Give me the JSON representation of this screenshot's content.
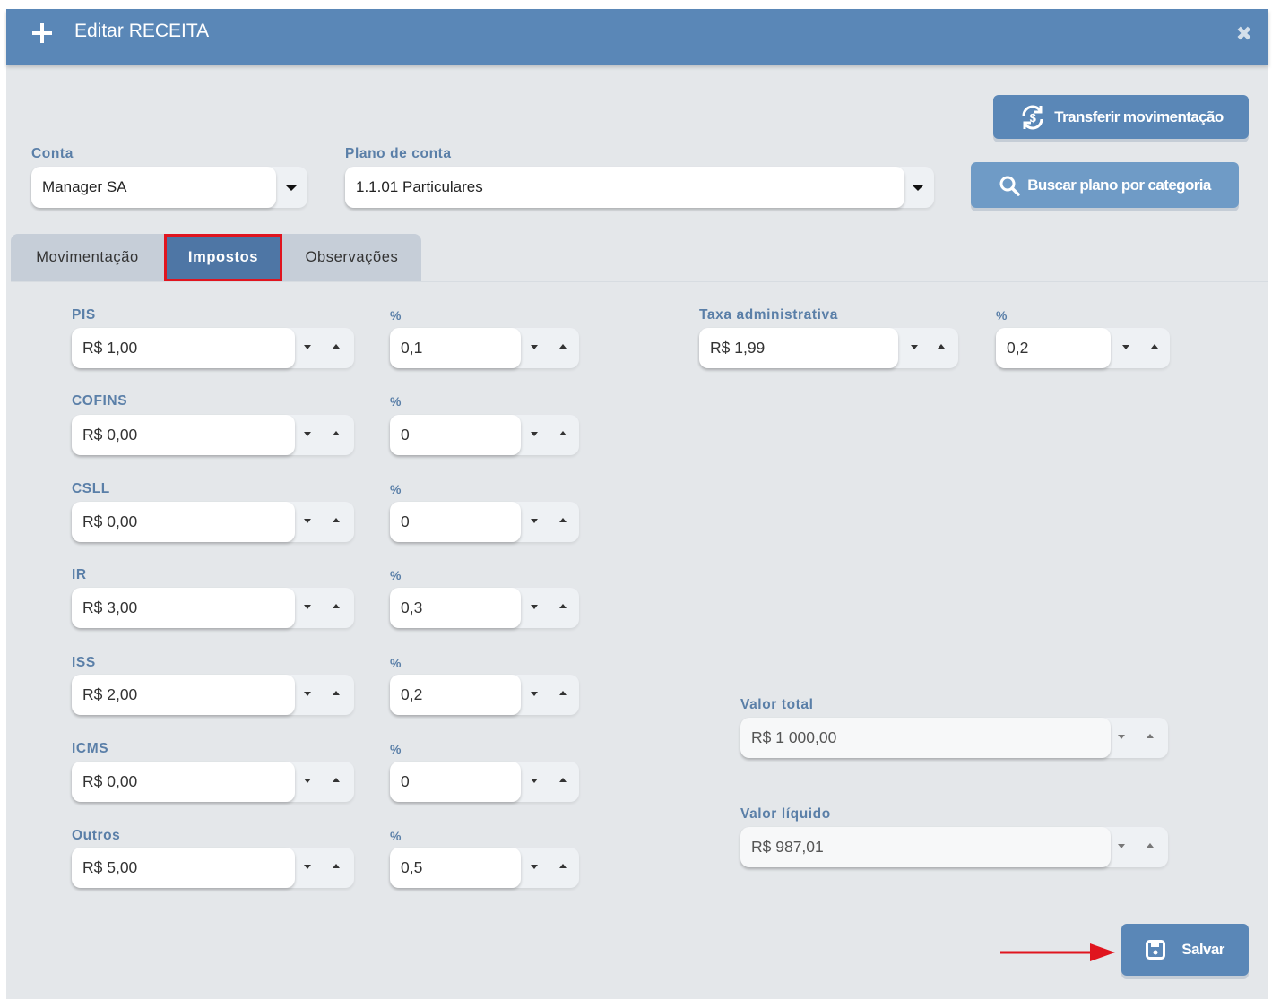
{
  "header": {
    "title": "Editar RECEITA"
  },
  "actions": {
    "transferir_label": "Transferir movimentação",
    "buscar_label": "Buscar plano por categoria",
    "salvar_label": "Salvar"
  },
  "conta": {
    "label": "Conta",
    "value": "Manager SA"
  },
  "plano": {
    "label": "Plano de conta",
    "value": "1.1.01 Particulares"
  },
  "tabs": [
    {
      "label": "Movimentação",
      "active": false
    },
    {
      "label": "Impostos",
      "active": true
    },
    {
      "label": "Observações",
      "active": false
    }
  ],
  "taxes": [
    {
      "label": "PIS",
      "value": "R$ 1,00",
      "pct_label": "%",
      "pct": "0,1"
    },
    {
      "label": "COFINS",
      "value": "R$ 0,00",
      "pct_label": "%",
      "pct": "0"
    },
    {
      "label": "CSLL",
      "value": "R$ 0,00",
      "pct_label": "%",
      "pct": "0"
    },
    {
      "label": "IR",
      "value": "R$ 3,00",
      "pct_label": "%",
      "pct": "0,3"
    },
    {
      "label": "ISS",
      "value": "R$ 2,00",
      "pct_label": "%",
      "pct": "0,2"
    },
    {
      "label": "ICMS",
      "value": "R$ 0,00",
      "pct_label": "%",
      "pct": "0"
    },
    {
      "label": "Outros",
      "value": "R$ 5,00",
      "pct_label": "%",
      "pct": "0,5"
    }
  ],
  "taxa_admin": {
    "label": "Taxa administrativa",
    "value": "R$ 1,99",
    "pct_label": "%",
    "pct": "0,2"
  },
  "totals": {
    "total_label": "Valor total",
    "total_value": "R$ 1 000,00",
    "liquido_label": "Valor líquido",
    "liquido_value": "R$ 987,01"
  },
  "colors": {
    "header": "#5a87b7",
    "active_tab": "#4e76a5",
    "highlight": "#e0151f",
    "label": "#5a7fa8"
  }
}
